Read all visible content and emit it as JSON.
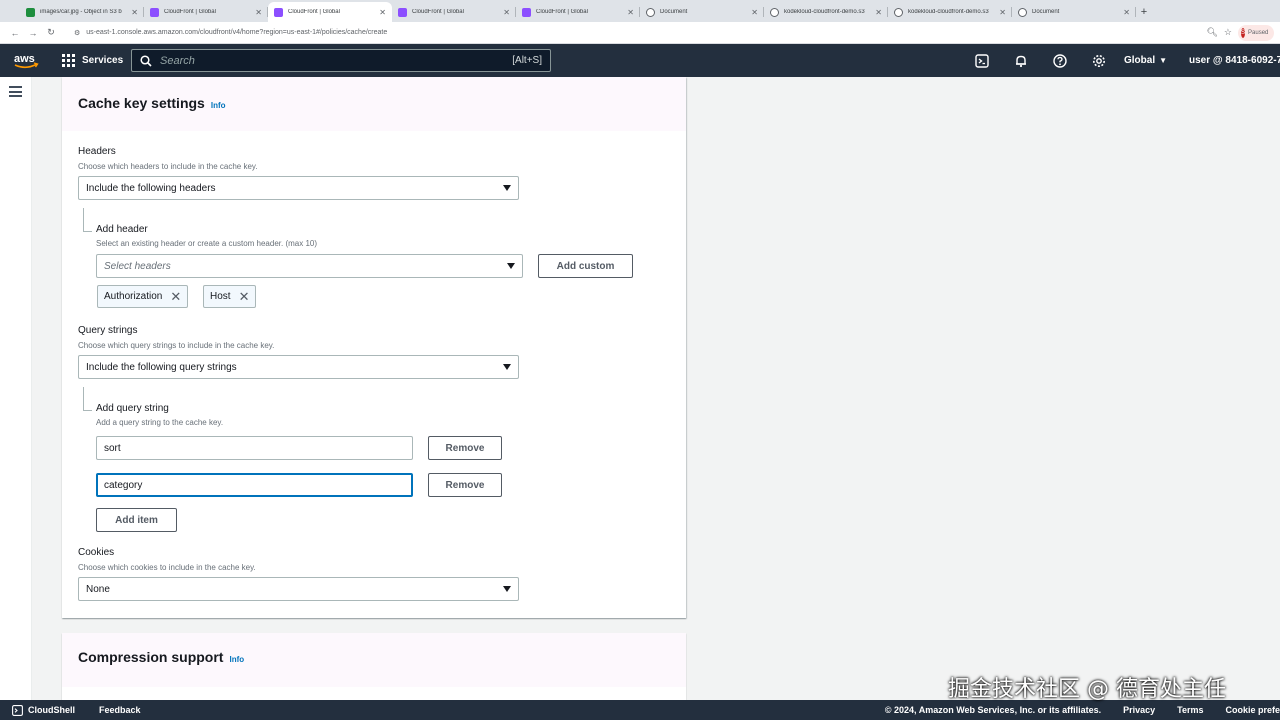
{
  "browser": {
    "tabs": [
      {
        "title": "images/car.jpg - Object in S3 b",
        "color": "#1e8e3e",
        "active": false
      },
      {
        "title": "CloudFront | Global",
        "color": "#8c4fff",
        "active": false
      },
      {
        "title": "CloudFront | Global",
        "color": "#8c4fff",
        "active": true
      },
      {
        "title": "CloudFront | Global",
        "color": "#8c4fff",
        "active": false
      },
      {
        "title": "CloudFront | Global",
        "color": "#8c4fff",
        "active": false
      },
      {
        "title": "Document",
        "color": "#5f6368",
        "active": false
      },
      {
        "title": "kodekloud-cloudfront-demo.s3",
        "color": "#5f6368",
        "active": false
      },
      {
        "title": "kodekloud-cloudfront-demo.s3",
        "color": "#5f6368",
        "active": false
      },
      {
        "title": "Document",
        "color": "#5f6368",
        "active": false
      }
    ],
    "new_tab": "+",
    "url": "us-east-1.console.aws.amazon.com/cloudfront/v4/home?region=us-east-1#/policies/cache/create",
    "profile_label": "Paused",
    "profile_initial": "S"
  },
  "aws_nav": {
    "logo": "aws",
    "services": "Services",
    "search_placeholder": "Search",
    "search_shortcut": "[Alt+S]",
    "region": "Global",
    "user": "user @ 8418-6092-7"
  },
  "cache_key": {
    "title": "Cache key settings",
    "info": "Info",
    "headers": {
      "label": "Headers",
      "desc": "Choose which headers to include in the cache key.",
      "selected": "Include the following headers",
      "add_label": "Add header",
      "add_desc": "Select an existing header or create a custom header. (max 10)",
      "placeholder": "Select headers",
      "add_custom": "Add custom",
      "tokens": [
        "Authorization",
        "Host"
      ]
    },
    "query_strings": {
      "label": "Query strings",
      "desc": "Choose which query strings to include in the cache key.",
      "selected": "Include the following query strings",
      "add_label": "Add query string",
      "add_desc": "Add a query string to the cache key.",
      "items": [
        "sort",
        "category"
      ],
      "remove": "Remove",
      "add_item": "Add item"
    },
    "cookies": {
      "label": "Cookies",
      "desc": "Choose which cookies to include in the cache key.",
      "selected": "None"
    }
  },
  "compression": {
    "title": "Compression support",
    "info": "Info"
  },
  "footer": {
    "cloudshell": "CloudShell",
    "feedback": "Feedback",
    "copyright": "© 2024, Amazon Web Services, Inc. or its affiliates.",
    "privacy": "Privacy",
    "terms": "Terms",
    "cookie": "Cookie prefe"
  },
  "watermark": "掘金技术社区 @ 德育处主任"
}
